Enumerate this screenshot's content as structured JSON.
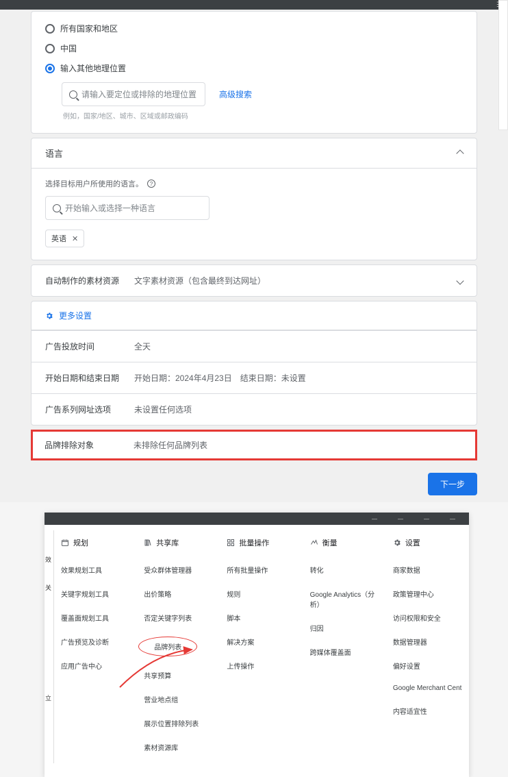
{
  "location": {
    "opt_all": "所有国家和地区",
    "opt_cn": "中国",
    "opt_other": "输入其他地理位置",
    "search_ph": "请输入要定位或排除的地理位置",
    "adv_search": "高级搜索",
    "hint": "例如，国家/地区、城市、区域或邮政编码"
  },
  "language": {
    "title": "语言",
    "desc": "选择目标用户所使用的语言。",
    "search_ph": "开始输入或选择一种语言",
    "chip": "英语"
  },
  "assets": {
    "label": "自动制作的素材资源",
    "value": "文字素材资源（包含最终到达网址）"
  },
  "more": {
    "title": "更多设置",
    "rows": [
      {
        "label": "广告投放时间",
        "value": "全天"
      },
      {
        "label": "开始日期和结束日期",
        "value": "开始日期：2024年4月23日 结束日期：未设置"
      },
      {
        "label": "广告系列网址选项",
        "value": "未设置任何选项"
      }
    ]
  },
  "brand": {
    "label": "品牌排除对象",
    "value": "未排除任何品牌列表"
  },
  "next_label": "下一步",
  "topnav": {
    "items": [
      "",
      "",
      "",
      ""
    ]
  },
  "menu": {
    "side_frags": [
      "效",
      "关",
      "立"
    ],
    "cols": [
      {
        "icon": "calendar",
        "title": "规划",
        "items": [
          "效果规划工具",
          "关键字规划工具",
          "覆盖面规划工具",
          "广告预览及诊断",
          "应用广告中心"
        ]
      },
      {
        "icon": "library",
        "title": "共享库",
        "items": [
          "受众群体管理器",
          "出价策略",
          "否定关键字列表",
          "品牌列表",
          "共享预算",
          "营业地点组",
          "展示位置排除列表",
          "素材资源库"
        ]
      },
      {
        "icon": "bulk",
        "title": "批量操作",
        "items": [
          "所有批量操作",
          "规则",
          "脚本",
          "解决方案",
          "上传操作"
        ]
      },
      {
        "icon": "ruler",
        "title": "衡量",
        "items": [
          "转化",
          "Google Analytics（分析）",
          "归因",
          "跨媒体覆盖面"
        ]
      },
      {
        "icon": "gear",
        "title": "设置",
        "items": [
          "商家数据",
          "政策管理中心",
          "访问权限和安全",
          "数据管理器",
          "偏好设置",
          "Google Merchant Cent",
          "内容适宜性"
        ]
      }
    ],
    "highlight_item": "品牌列表"
  }
}
